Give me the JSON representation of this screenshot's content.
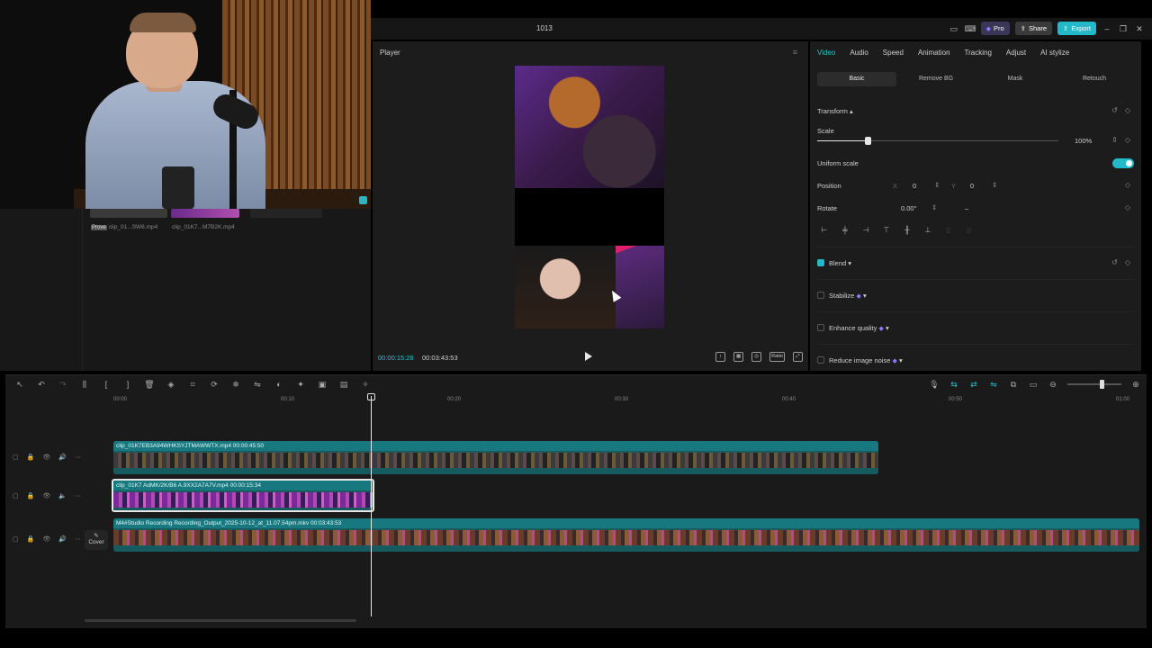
{
  "window": {
    "title": "1013"
  },
  "titlebar": {
    "pro_label": "Pro",
    "share_label": "Share",
    "export_label": "Export"
  },
  "media": {
    "items": [
      {
        "tag": "Prove",
        "name": "clip_01...SW6.mp4"
      },
      {
        "name": "clip_01K7...M7B2K.mp4"
      }
    ]
  },
  "player": {
    "header": "Player",
    "current_time": "00:00:15:28",
    "total_time": "00:03:43:53",
    "ratio_label": "Ratio"
  },
  "inspector": {
    "tabs": [
      "Video",
      "Audio",
      "Speed",
      "Animation",
      "Tracking",
      "Adjust",
      "AI stylize"
    ],
    "subtabs": [
      "Basic",
      "Remove BG",
      "Mask",
      "Retouch"
    ],
    "transform_label": "Transform",
    "scale_label": "Scale",
    "scale_value": "100%",
    "scale_level": 0.21,
    "uniform_scale_label": "Uniform scale",
    "uniform_scale_on": true,
    "position_label": "Position",
    "position_x_label": "X",
    "position_x": "0",
    "position_y_label": "Y",
    "position_y": "0",
    "rotate_label": "Rotate",
    "rotate_value": "0.00°",
    "rotate_dash": "–",
    "blend_label": "Blend",
    "blend_on": true,
    "stabilize_label": "Stabilize",
    "enhance_label": "Enhance quality",
    "noise_label": "Reduce image noise"
  },
  "timeline": {
    "ruler": [
      "00:00",
      "00:10",
      "00:20",
      "00:30",
      "00:40",
      "00:50",
      "01:00"
    ],
    "clips": [
      {
        "label": "clip_01K7EB3A94WHKSYJTMAWWTX.mp4  00:00:45:50"
      },
      {
        "label": "clip_01K7 AdMK/2K/B6 A.9XX2A7A7V.mp4  00:00:15:34"
      },
      {
        "label": "M4#Studio Recording Recording_Output_2025-10-12_at_11.07.54pm.mkv  00:03:43:53"
      }
    ],
    "cover_label": "Cover"
  },
  "colors": {
    "accent": "#22b9c8",
    "pro": "#3a3658"
  }
}
